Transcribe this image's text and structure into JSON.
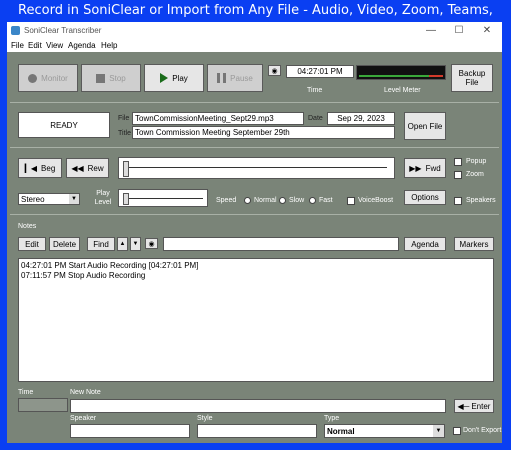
{
  "banner": "Record in SoniClear or Import  from Any File - Audio, Video, Zoom, Teams, Webex",
  "window": {
    "title": "SoniClear Transcriber",
    "minimize": "—",
    "maximize": "☐",
    "close": "✕"
  },
  "menu": [
    "File",
    "Edit",
    "View",
    "Agenda",
    "Help"
  ],
  "transport": {
    "monitor": "Monitor",
    "stop": "Stop",
    "play": "Play",
    "pause": "Pause",
    "time_value": "04:27:01 PM",
    "time_label": "Time",
    "level_label": "Level Meter",
    "backup": "Backup File"
  },
  "file_info": {
    "status": "READY",
    "file_label": "File",
    "file_value": "TownCommissionMeeting_Sept29.mp3",
    "date_label": "Date",
    "date_value": "Sep 29, 2023",
    "title_label": "Title",
    "title_value": "Town Commission Meeting September 29th",
    "open_file": "Open File"
  },
  "playback": {
    "beg": "Beg",
    "rew": "Rew",
    "fwd": "Fwd",
    "popup": "Popup",
    "zoom": "Zoom",
    "channel": "Stereo",
    "play_level": "Play Level",
    "speed_label": "Speed",
    "speed_normal": "Normal",
    "speed_slow": "Slow",
    "speed_fast": "Fast",
    "voiceboost": "VoiceBoost",
    "options": "Options",
    "speakers": "Speakers"
  },
  "notes": {
    "heading": "Notes",
    "edit": "Edit",
    "delete": "Delete",
    "find": "Find",
    "agenda": "Agenda",
    "markers": "Markers",
    "entries": [
      "04:27:01 PM  Start Audio Recording [04:27:01 PM]",
      "07:11:57 PM  Stop Audio Recording"
    ]
  },
  "new_note": {
    "time_label": "Time",
    "new_note_label": "New Note",
    "enter": "Enter",
    "speaker_label": "Speaker",
    "style_label": "Style",
    "type_label": "Type",
    "type_value": "Normal",
    "dont_export": "Don't Export"
  },
  "colors": {
    "banner_bg": "#0a3ff2",
    "window_bg": "#7a8478",
    "play_green": "#1a6b1a"
  }
}
